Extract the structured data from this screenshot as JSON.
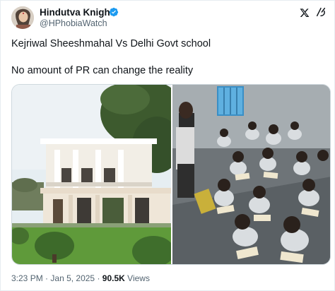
{
  "author": {
    "display_name": "Hindutva Knight",
    "handle": "@HPhobiaWatch",
    "verified": true
  },
  "tweet": {
    "line1": "Kejriwal Sheeshmahal Vs Delhi Govt school",
    "line2": "No amount of PR can change the reality"
  },
  "media": {
    "left_image": "white-bungalow-photo",
    "right_image": "classroom-children-on-floor-photo"
  },
  "meta": {
    "time": "3:23 PM",
    "separator": "·",
    "date": "Jan 5, 2025",
    "views_count": "90.5K",
    "views_label": "Views"
  },
  "colors": {
    "text": "#0f1419",
    "secondary": "#536471",
    "verified": "#1d9bf0",
    "border": "#cfd9de"
  },
  "icons": {
    "verified": "verified-badge-icon",
    "brand": "x-logo-icon",
    "grok": "grok-icon"
  }
}
